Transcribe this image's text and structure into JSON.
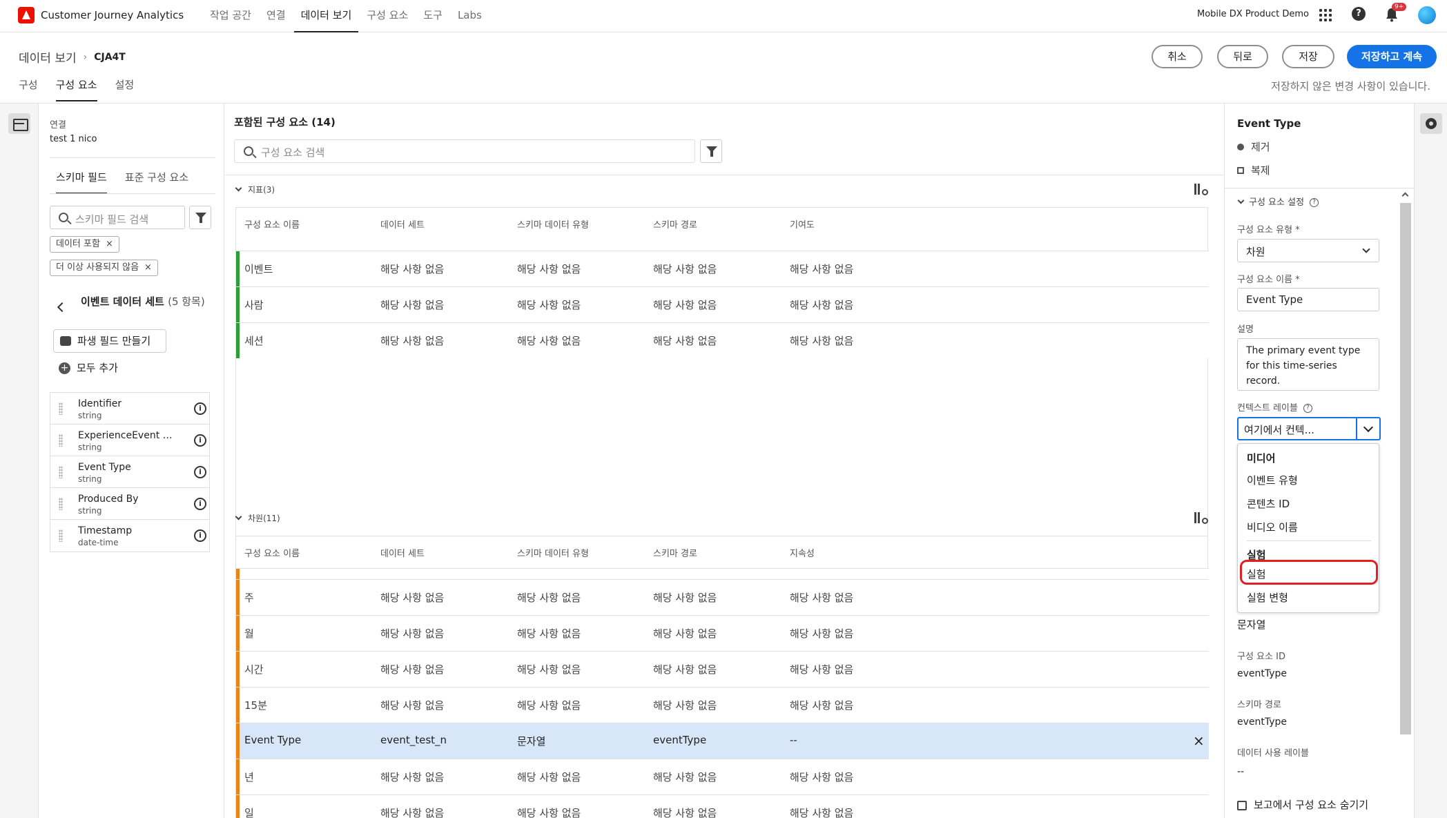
{
  "app": {
    "title": "Customer Journey Analytics",
    "org": "Mobile DX Product Demo",
    "notification_count": "9+"
  },
  "nav": {
    "items": [
      "작업 공간",
      "연결",
      "데이터 보기",
      "구성 요소",
      "도구",
      "Labs"
    ],
    "active": "데이터 보기"
  },
  "header": {
    "breadcrumb_root": "데이터 보기",
    "breadcrumb_current": "CJA4T",
    "buttons": {
      "cancel": "취소",
      "back": "뒤로",
      "save": "저장",
      "save_continue": "저장하고 계속"
    },
    "tabs": [
      "구성",
      "구성 요소",
      "설정"
    ],
    "active_tab": "구성 요소",
    "unsaved_msg": "저장하지 않은 변경 사항이 있습니다."
  },
  "left": {
    "connection_label": "연결",
    "connection_value": "test 1 nico",
    "tabs": [
      "스키마 필드",
      "표준 구성 요소"
    ],
    "search_placeholder": "스키마 필드 검색",
    "chips": [
      "데이터 포함",
      "더 이상 사용되지 않음"
    ],
    "dataset_title": "이벤트 데이터 세트",
    "dataset_count": "(5 항목)",
    "create_field": "파생 필드 만들기",
    "add_all": "모두 추가",
    "fields": [
      {
        "name": "Identifier",
        "type": "string"
      },
      {
        "name": "ExperienceEvent metadata",
        "type": "string"
      },
      {
        "name": "Event Type",
        "type": "string"
      },
      {
        "name": "Produced By",
        "type": "string"
      },
      {
        "name": "Timestamp",
        "type": "date-time"
      }
    ]
  },
  "center": {
    "title": "포함된 구성 요소 (14)",
    "search_placeholder": "구성 요소 검색",
    "metrics": {
      "header": "지표(3)",
      "columns": [
        "구성 요소 이름",
        "데이터 세트",
        "스키마 데이터 유형",
        "스키마 경로",
        "기여도"
      ],
      "rows": [
        [
          "이벤트",
          "해당 사항 없음",
          "해당 사항 없음",
          "해당 사항 없음",
          "해당 사항 없음"
        ],
        [
          "사람",
          "해당 사항 없음",
          "해당 사항 없음",
          "해당 사항 없음",
          "해당 사항 없음"
        ],
        [
          "세션",
          "해당 사항 없음",
          "해당 사항 없음",
          "해당 사항 없음",
          "해당 사항 없음"
        ]
      ]
    },
    "dimensions": {
      "header": "차원(11)",
      "columns": [
        "구성 요소 이름",
        "데이터 세트",
        "스키마 데이터 유형",
        "스키마 경로",
        "지속성"
      ],
      "rows": [
        [
          "주",
          "해당 사항 없음",
          "해당 사항 없음",
          "해당 사항 없음",
          "해당 사항 없음"
        ],
        [
          "월",
          "해당 사항 없음",
          "해당 사항 없음",
          "해당 사항 없음",
          "해당 사항 없음"
        ],
        [
          "시간",
          "해당 사항 없음",
          "해당 사항 없음",
          "해당 사항 없음",
          "해당 사항 없음"
        ],
        [
          "15분",
          "해당 사항 없음",
          "해당 사항 없음",
          "해당 사항 없음",
          "해당 사항 없음"
        ],
        [
          "Event Type",
          "event_test_n",
          "문자열",
          "eventType",
          "--"
        ],
        [
          "년",
          "해당 사항 없음",
          "해당 사항 없음",
          "해당 사항 없음",
          "해당 사항 없음"
        ],
        [
          "일",
          "해당 사항 없음",
          "해당 사항 없음",
          "해당 사항 없음",
          "해당 사항 없음"
        ]
      ],
      "selected_row": 4
    }
  },
  "right": {
    "title": "Event Type",
    "remove": "제거",
    "duplicate": "복제",
    "section": "구성 요소 설정",
    "type_label": "구성 요소 유형 *",
    "type_value": "차원",
    "name_label": "구성 요소 이름 *",
    "name_value": "Event Type",
    "desc_label": "설명",
    "desc_value": "The primary event type for this time-series record.",
    "ctx_label": "컨텍스트 레이블",
    "ctx_value": "여기에서 컨텍...",
    "dropdown": {
      "group1": "미디어",
      "items1": [
        "이벤트 유형",
        "콘텐츠 ID",
        "비디오 이름"
      ],
      "group2": "실험",
      "items2": [
        "실험",
        "실험 변형"
      ]
    },
    "schema_type_value": "문자열",
    "component_id_label": "구성 요소 ID",
    "component_id_value": "eventType",
    "schema_path_label": "스키마 경로",
    "schema_path_value": "eventType",
    "usage_label_label": "데이터 사용 레이블",
    "usage_label_value": "--",
    "hide_label": "보고에서 구성 요소 숨기기"
  },
  "colors": {
    "accent": "#1473e6",
    "metric_bar": "#2d9d3a",
    "dimension_bar": "#e68619",
    "selected_row": "#d7e6f8",
    "highlight": "#e02020"
  }
}
